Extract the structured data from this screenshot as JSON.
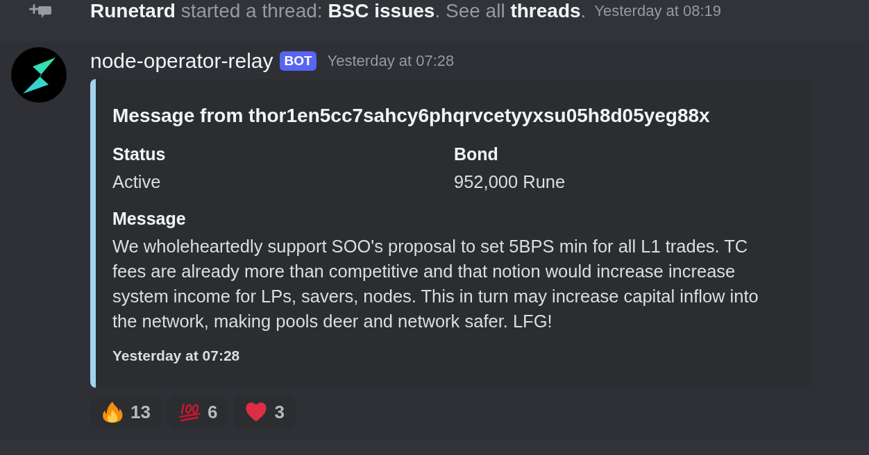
{
  "notice": {
    "parts": [
      {
        "kind": "user",
        "text": "Runetard"
      },
      {
        "kind": "text",
        "text": " started a thread: "
      },
      {
        "kind": "link",
        "text": "BSC issues"
      },
      {
        "kind": "text",
        "text": ". See all "
      },
      {
        "kind": "link",
        "text": "threads"
      },
      {
        "kind": "text",
        "text": "."
      }
    ],
    "time": "Yesterday at 08:19"
  },
  "message": {
    "author": "node-operator-relay",
    "badge": "BOT",
    "time": "Yesterday at 07:28",
    "embed": {
      "title": "Message from thor1en5cc7sahcy6phqrvcetyyxsu05h8d05yeg88x",
      "fields": [
        {
          "name": "Status",
          "value": "Active",
          "inline": true
        },
        {
          "name": "Bond",
          "value": "952,000 Rune",
          "inline": true
        },
        {
          "name": "Message",
          "value": "We wholeheartedly support SOO's proposal to set 5BPS min for all L1 trades. TC fees are already more than competitive and that notion would increase increase system income for LPs, savers, nodes. This in turn may increase capital inflow into the network, making pools deer and network safer. LFG!",
          "inline": false
        }
      ],
      "footer": "Yesterday at 07:28"
    },
    "reactions": [
      {
        "kind": "fire",
        "count": "13",
        "selected": false
      },
      {
        "kind": "hundred",
        "count": "6",
        "selected": false
      },
      {
        "kind": "heart",
        "count": "3",
        "selected": false
      }
    ]
  }
}
